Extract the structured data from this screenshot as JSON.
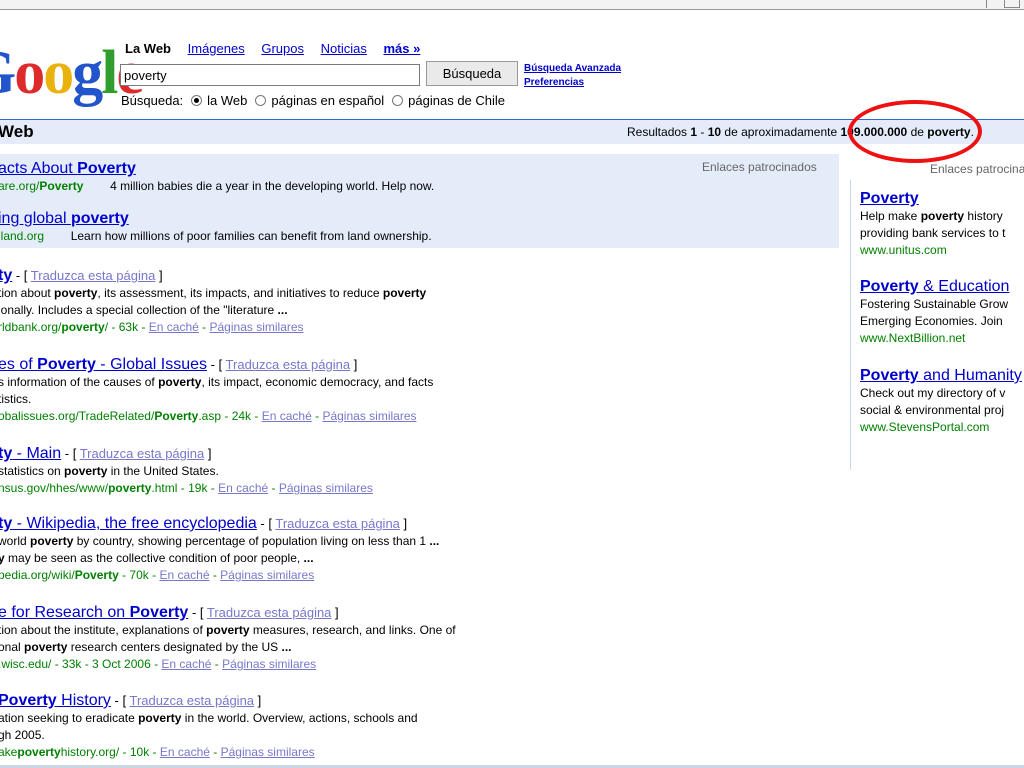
{
  "logo": {
    "p1": "o",
    "p2": "o",
    "p3": "g",
    "p4": "l",
    "p5": "e"
  },
  "tabs": {
    "web": "La Web",
    "images": "Imágenes",
    "groups": "Grupos",
    "news": "Noticias",
    "more": "más »"
  },
  "search": {
    "value": "poverty",
    "button": "Búsqueda",
    "advanced": "Búsqueda Avanzada",
    "prefs": "Preferencias"
  },
  "scope": {
    "label": "Búsqueda:",
    "opt1": "la Web",
    "opt2": "páginas en español",
    "opt3": "páginas de Chile"
  },
  "results_bar": {
    "title": "Web",
    "pre": "Resultados ",
    "from": "1",
    "dash": " - ",
    "to": "10",
    "mid": " de aproximadamente ",
    "total": "109.000.000",
    "de": " de ",
    "query": "poverty",
    "end": "."
  },
  "sponsored_label": "Enlaces patrocinados",
  "sponsored_top": [
    {
      "title_pre": "acts About ",
      "title_bold": "Poverty",
      "url_pre": "are.org/",
      "url_bold": "Poverty",
      "desc": "4 million babies die a year in the developing world. Help now."
    },
    {
      "title_pre": "ing global ",
      "title_bold": "poverty",
      "url_pre": "iland.org",
      "url_bold": "",
      "desc": "Learn how millions of poor families can benefit from land ownership."
    }
  ],
  "translate_label": "Traduzca esta página",
  "cache_label": "En caché",
  "similar_label": "Páginas similares",
  "results": [
    {
      "t1": "",
      "tb": "ty",
      "t2": "",
      "s1": [
        {
          "t": "tion about "
        },
        {
          "b": "poverty"
        },
        {
          "t": ", its assessment, its impacts, and initiatives to reduce "
        },
        {
          "b": "poverty"
        }
      ],
      "s2": [
        {
          "t": "ionally. Includes a special collection of the \"literature "
        },
        {
          "b": "..."
        }
      ],
      "u1": "rldbank.org/",
      "ub": "poverty",
      "u2": "/",
      "size": "63k"
    },
    {
      "t1": "es of ",
      "tb": "Poverty",
      "t2": " - Global Issues",
      "s1": [
        {
          "t": "s information of the causes of "
        },
        {
          "b": "poverty"
        },
        {
          "t": ", its impact, economic democracy, and facts"
        }
      ],
      "s2": [
        {
          "t": "tistics."
        }
      ],
      "u1": "obalissues.org/TradeRelated/",
      "ub": "Poverty",
      "u2": ".asp",
      "size": "24k"
    },
    {
      "t1": "",
      "tb": "ty",
      "t2": " - Main",
      "s1": [
        {
          "t": "statistics on "
        },
        {
          "b": "poverty"
        },
        {
          "t": " in the United States."
        }
      ],
      "s2": [],
      "u1": "nsus.gov/hhes/www/",
      "ub": "poverty",
      "u2": ".html",
      "size": "19k"
    },
    {
      "t1": "",
      "tb": "ty",
      "t2": " - Wikipedia, the free encyclopedia",
      "s1": [
        {
          "t": "world "
        },
        {
          "b": "poverty"
        },
        {
          "t": " by country, showing percentage of population living on less than 1 "
        },
        {
          "b": "..."
        }
      ],
      "s2": [
        {
          "b": "y"
        },
        {
          "t": " may be seen as the collective condition of poor people, "
        },
        {
          "b": "..."
        }
      ],
      "u1": "pedia.org/wiki/",
      "ub": "Poverty",
      "u2": "",
      "size": "70k"
    },
    {
      "t1": "e for Research on ",
      "tb": "Poverty",
      "t2": "",
      "s1": [
        {
          "t": "tion about the institute, explanations of "
        },
        {
          "b": "poverty"
        },
        {
          "t": " measures, research, and links. One of"
        }
      ],
      "s2": [
        {
          "t": "onal "
        },
        {
          "b": "poverty"
        },
        {
          "t": " research centers designated by the US "
        },
        {
          "b": "..."
        }
      ],
      "u1": ".wisc.edu/",
      "ub": "",
      "u2": "",
      "size": "33k - 3 Oct 2006"
    },
    {
      "t1": "",
      "tb": "Poverty",
      "t2": " History",
      "s1": [
        {
          "t": "ation seeking to eradicate "
        },
        {
          "b": "poverty"
        },
        {
          "t": " in the world. Overview, actions, schools and"
        }
      ],
      "s2": [
        {
          "t": "gh 2005."
        }
      ],
      "u1": "ake",
      "ub": "poverty",
      "u2": "history.org/",
      "size": "10k"
    }
  ],
  "sponsored_right": [
    {
      "tb": "Poverty",
      "t2": "",
      "d1": [
        {
          "t": "Help make "
        },
        {
          "b": "poverty"
        },
        {
          "t": " history"
        }
      ],
      "d2": "providing bank services to t",
      "url": "www.unitus.com"
    },
    {
      "tb": "Poverty",
      "t2": " & Education",
      "d1": [
        {
          "t": "Fostering Sustainable Grow"
        }
      ],
      "d2": "Emerging Economies. Join",
      "url": "www.NextBillion.net"
    },
    {
      "tb": "Poverty",
      "t2": " and Humanity",
      "d1": [
        {
          "t": "Check out my directory of v"
        }
      ],
      "d2": "social & environmental proj",
      "url": "www.StevensPortal.com"
    }
  ],
  "colors": {
    "link": "#0000cc",
    "url": "#008000",
    "accent_circle": "#ee1111",
    "bar": "#e5ecf9"
  }
}
